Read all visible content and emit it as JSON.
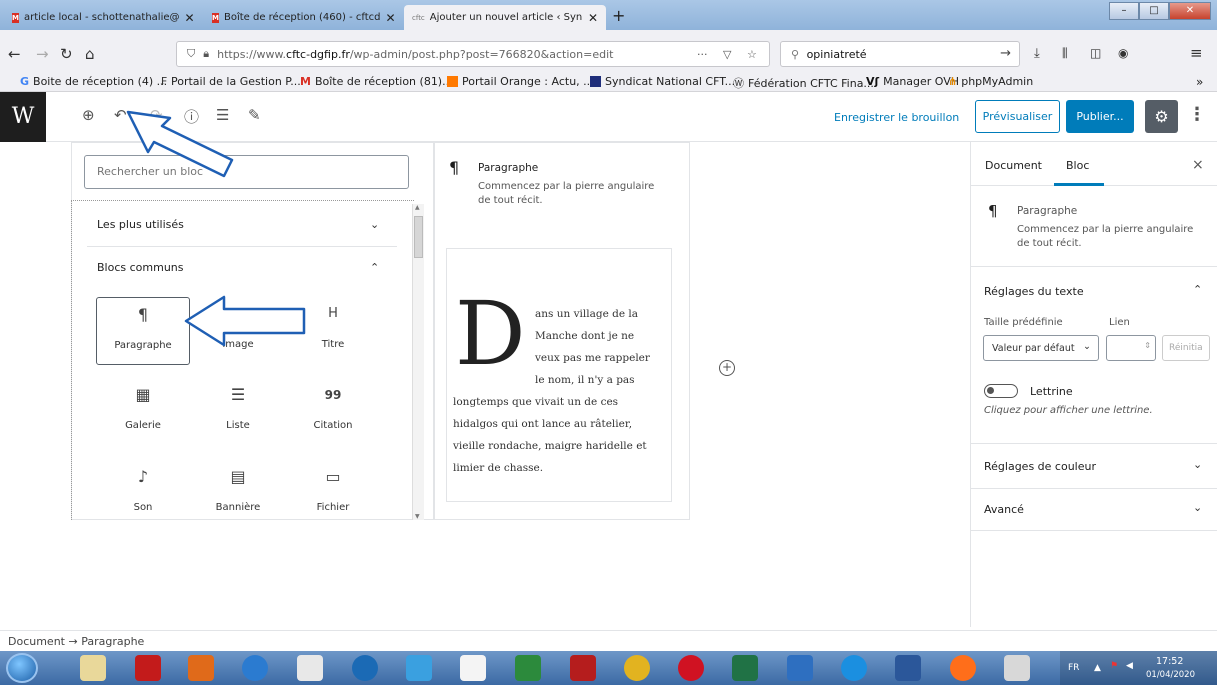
{
  "browser": {
    "tabs": [
      {
        "label": "article local - schottenathalie@",
        "active": false
      },
      {
        "label": "Boîte de réception (460) - cftcd",
        "active": false
      },
      {
        "label": "Ajouter un nouvel article ‹ Syn",
        "active": true
      }
    ],
    "url_prefix": "https://www.",
    "url_domain": "cftc-dgfip.fr",
    "url_rest": "/wp-admin/post.php?post=766820&action=edit",
    "url_more": "···",
    "search_value": "opiniatreté",
    "bookmarks": [
      "Boite de réception (4) ...",
      "Portail de la Gestion P...",
      "Boîte de réception (81)...",
      "Portail Orange : Actu, ...",
      "Syndicat National CFT...",
      "Fédération CFTC Fina...",
      "Manager OVH",
      "phpMyAdmin"
    ],
    "bookmarks_more": "»"
  },
  "editor": {
    "logo": "W",
    "save_draft": "Enregistrer le brouillon",
    "preview": "Prévisualiser",
    "publish": "Publier...",
    "settings_icon": "gear-icon",
    "more_icon": "⋮"
  },
  "inserter": {
    "search_placeholder": "Rechercher un bloc",
    "section_most_used": "Les plus utilisés",
    "section_common": "Blocs communs",
    "blocks": [
      {
        "label": "Paragraphe",
        "icon": "¶"
      },
      {
        "label": "Image",
        "icon": "▣"
      },
      {
        "label": "Titre",
        "icon": "H"
      },
      {
        "label": "Galerie",
        "icon": "▦"
      },
      {
        "label": "Liste",
        "icon": "☰"
      },
      {
        "label": "Citation",
        "icon": "99"
      },
      {
        "label": "Son",
        "icon": "♪"
      },
      {
        "label": "Bannière",
        "icon": "▤"
      },
      {
        "label": "Fichier",
        "icon": "▭"
      }
    ]
  },
  "block_preview": {
    "title": "Paragraphe",
    "description_line1": "Commencez par la pierre angulaire",
    "description_line2": "de tout récit.",
    "dropcap": "D",
    "lines": [
      "ans un village de la",
      "Manche dont je ne",
      "veux pas me rappeler",
      "le nom, il n'y a pas",
      "longtemps que vivait un de ces",
      "hidalgos qui ont lance au râtelier,",
      "vieille rondache, maigre haridelle et",
      "limier de chasse."
    ]
  },
  "sidebar": {
    "tab_document": "Document",
    "tab_block": "Bloc",
    "close": "×",
    "block_title": "Paragraphe",
    "block_desc1": "Commencez par la pierre angulaire",
    "block_desc2": "de tout récit.",
    "text_settings": "Réglages du texte",
    "preset_size_label": "Taille prédéfinie",
    "link_label": "Lien",
    "preset_value": "Valeur par défaut",
    "reset": "Réinitia",
    "dropcap_label": "Lettrine",
    "dropcap_help": "Cliquez pour afficher une lettrine.",
    "color_settings": "Réglages de couleur",
    "advanced": "Avancé"
  },
  "statusbar": {
    "breadcrumb_root": "Document",
    "arrow": "→",
    "breadcrumb_leaf": "Paragraphe"
  },
  "taskbar": {
    "lang": "FR",
    "time": "17:52",
    "date": "01/04/2020"
  },
  "colors": {
    "accent": "#007cba",
    "annotation_arrow": "#1f5fb4"
  }
}
